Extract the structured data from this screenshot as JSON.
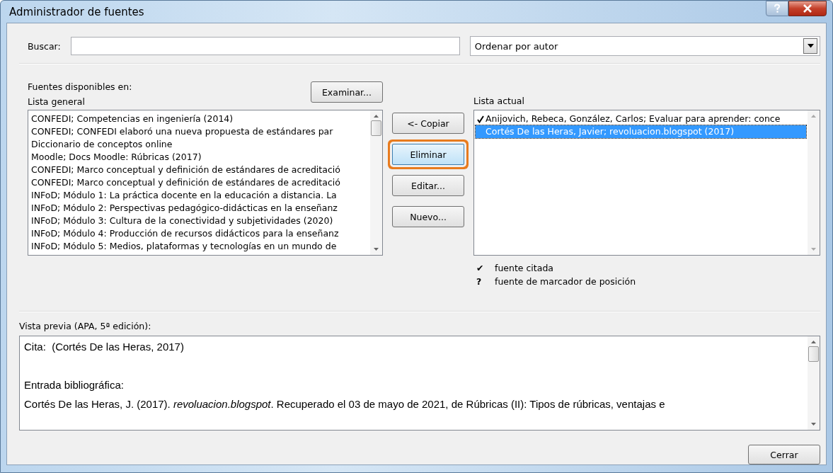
{
  "window": {
    "title": "Administrador de fuentes"
  },
  "search": {
    "label": "Buscar:"
  },
  "sort": {
    "value": "Ordenar por autor"
  },
  "sources_label": "Fuentes disponibles en:",
  "general_list": {
    "label": "Lista general",
    "items": [
      {
        "text": "CONFEDI; Competencias en ingeniería (2014)",
        "selected": false
      },
      {
        "text": "CONFEDI; CONFEDI elaboró una nueva propuesta de estándares par",
        "selected": false
      },
      {
        "text": "Diccionario de conceptos online",
        "selected": false
      },
      {
        "text": "Moodle; Docs Moodle: Rúbricas (2017)",
        "selected": false
      },
      {
        "text": "CONFEDI; Marco conceptual y definición de estándares de acreditació",
        "selected": false
      },
      {
        "text": "CONFEDI; Marco conceptual y definición de estándares de acreditació",
        "selected": false
      },
      {
        "text": "INFoD; Módulo 1: La práctica docente en la educación a distancia. La",
        "selected": false
      },
      {
        "text": "INFoD; Módulo 2: Perspectivas pedagógico-didácticas en la enseñanz",
        "selected": false
      },
      {
        "text": "INFoD; Módulo 3: Cultura de la conectividad y subjetividades (2020)",
        "selected": false
      },
      {
        "text": "INFoD; Módulo 4: Producción de recursos didácticos para la enseñanz",
        "selected": false
      },
      {
        "text": "INFoD; Módulo 5: Medios, plataformas y tecnologías en un mundo de",
        "selected": false
      }
    ]
  },
  "browse_button": "Examinar...",
  "action_buttons": [
    {
      "label": "<- Copiar",
      "highlighted": false
    },
    {
      "label": "Eliminar",
      "highlighted": true
    },
    {
      "label": "Editar...",
      "highlighted": false
    },
    {
      "label": "Nuevo...",
      "highlighted": false
    }
  ],
  "current_list": {
    "label": "Lista actual",
    "items": [
      {
        "text": "Anijovich, Rebeca, González, Carlos; Evaluar para aprender: conce",
        "cited": true,
        "selected": false
      },
      {
        "text": "Cortés De las Heras, Javier; revoluacion.blogspot (2017)",
        "cited": false,
        "selected": true
      }
    ]
  },
  "legend": [
    {
      "symbol": "✔",
      "text": "fuente citada"
    },
    {
      "symbol": "?",
      "text": "fuente de marcador de posición"
    }
  ],
  "preview": {
    "label": "Vista previa (APA, 5ª edición):",
    "lines": [
      {
        "kind": "text",
        "text": "Cita:  (Cortés De las Heras, 2017)"
      },
      {
        "kind": "blank"
      },
      {
        "kind": "text",
        "text": "Entrada bibliográfica:"
      },
      {
        "kind": "text",
        "text": "Cortés De las Heras, J. (2017). *revoluacion.blogspot*. Recuperado el 03 de mayo de 2021, de Rúbricas (II): Tipos de rúbricas, ventajas e"
      }
    ]
  },
  "close_button": "Cerrar"
}
